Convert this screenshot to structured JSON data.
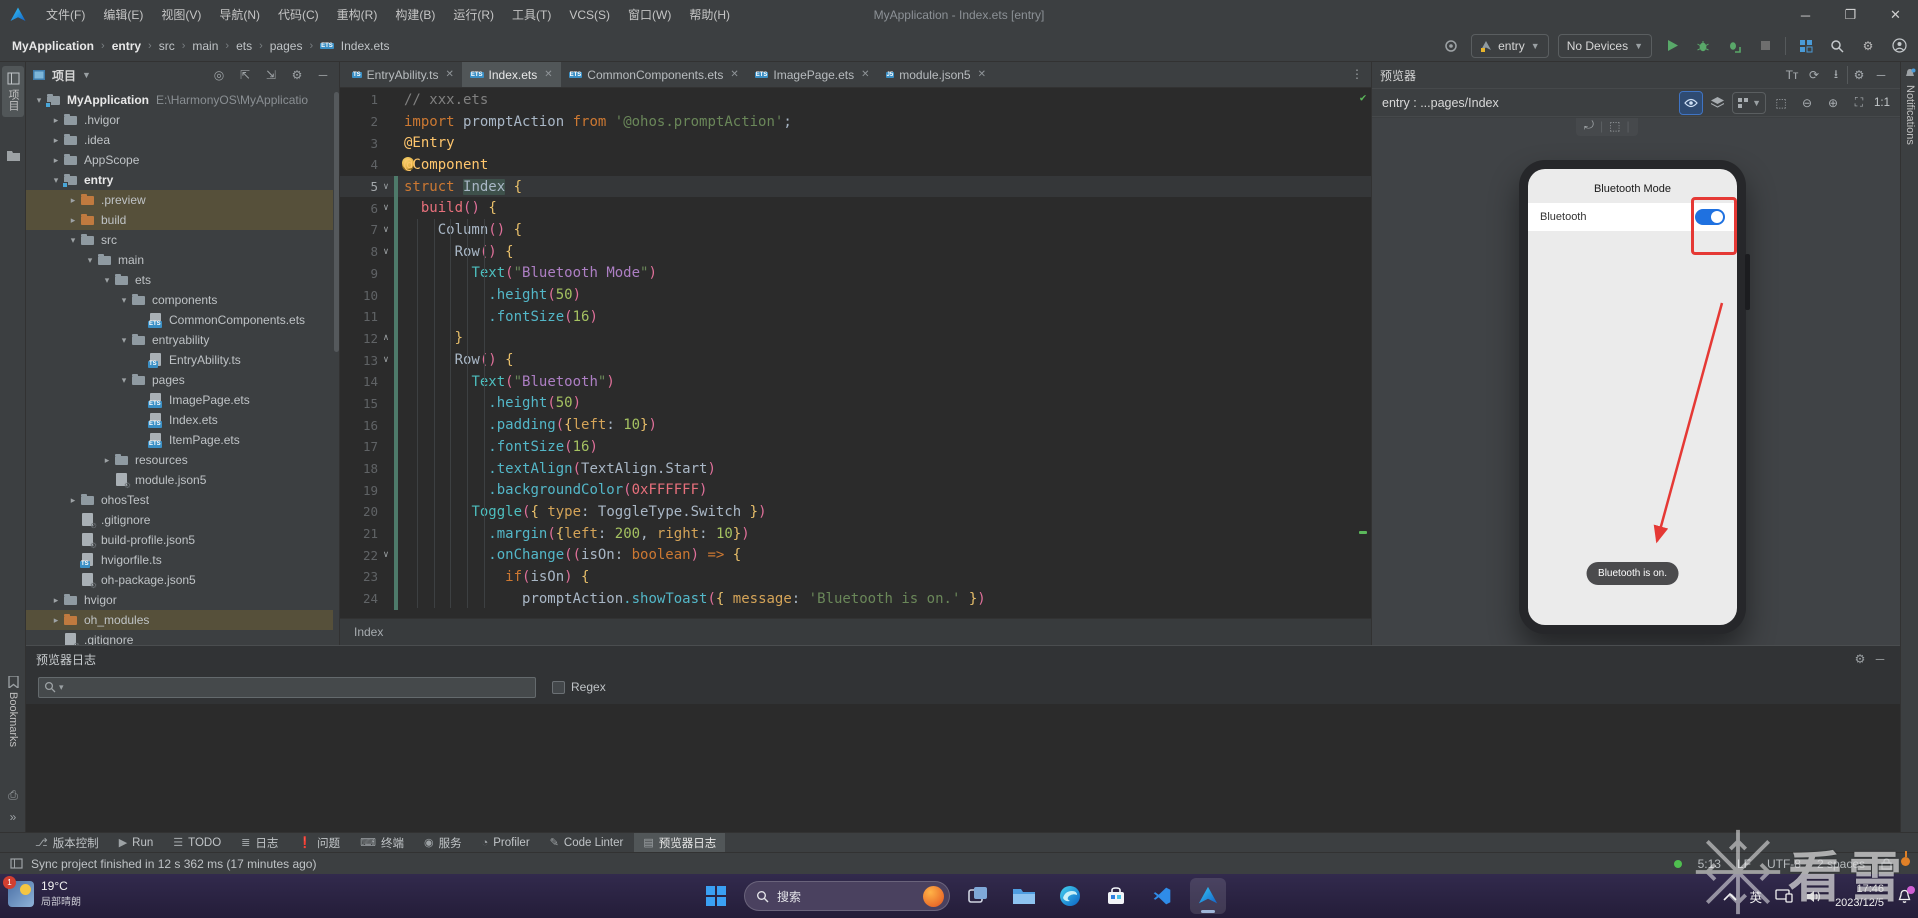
{
  "window": {
    "title": "MyApplication - Index.ets [entry]",
    "menus": [
      "文件(F)",
      "编辑(E)",
      "视图(V)",
      "导航(N)",
      "代码(C)",
      "重构(R)",
      "构建(B)",
      "运行(R)",
      "工具(T)",
      "VCS(S)",
      "窗口(W)",
      "帮助(H)"
    ]
  },
  "toolbar": {
    "breadcrumbs": [
      "MyApplication",
      "entry",
      "src",
      "main",
      "ets",
      "pages",
      "Index.ets"
    ],
    "module_selector": "entry",
    "device_selector": "No Devices"
  },
  "left_strip": {
    "project_tab": "项目",
    "bookmarks_tab": "Bookmarks"
  },
  "project": {
    "title": "项目",
    "tree": [
      {
        "label": "MyApplication",
        "depth": 0,
        "kind": "folder",
        "open": true,
        "bold": true,
        "badge": true,
        "suffix": "E:\\HarmonyOS\\MyApplicatio"
      },
      {
        "label": ".hvigor",
        "depth": 1,
        "kind": "folder",
        "open": false
      },
      {
        "label": ".idea",
        "depth": 1,
        "kind": "folder",
        "open": false
      },
      {
        "label": "AppScope",
        "depth": 1,
        "kind": "folder",
        "open": false
      },
      {
        "label": "entry",
        "depth": 1,
        "kind": "folder",
        "open": true,
        "bold": true,
        "badge": true
      },
      {
        "label": ".preview",
        "depth": 2,
        "kind": "folder-excluded",
        "open": false,
        "highlight": true
      },
      {
        "label": "build",
        "depth": 2,
        "kind": "folder-excluded",
        "open": false,
        "highlight": true
      },
      {
        "label": "src",
        "depth": 2,
        "kind": "folder",
        "open": true
      },
      {
        "label": "main",
        "depth": 3,
        "kind": "folder",
        "open": true
      },
      {
        "label": "ets",
        "depth": 4,
        "kind": "folder",
        "open": true
      },
      {
        "label": "components",
        "depth": 5,
        "kind": "folder",
        "open": true
      },
      {
        "label": "CommonComponents.ets",
        "depth": 6,
        "kind": "file-ets"
      },
      {
        "label": "entryability",
        "depth": 5,
        "kind": "folder",
        "open": true
      },
      {
        "label": "EntryAbility.ts",
        "depth": 6,
        "kind": "file-ts"
      },
      {
        "label": "pages",
        "depth": 5,
        "kind": "folder",
        "open": true
      },
      {
        "label": "ImagePage.ets",
        "depth": 6,
        "kind": "file-ets"
      },
      {
        "label": "Index.ets",
        "depth": 6,
        "kind": "file-ets"
      },
      {
        "label": "ItemPage.ets",
        "depth": 6,
        "kind": "file-ets"
      },
      {
        "label": "resources",
        "depth": 4,
        "kind": "folder",
        "open": false
      },
      {
        "label": "module.json5",
        "depth": 4,
        "kind": "file-json"
      },
      {
        "label": "ohosTest",
        "depth": 2,
        "kind": "folder",
        "open": false
      },
      {
        "label": ".gitignore",
        "depth": 2,
        "kind": "file-ignored"
      },
      {
        "label": "build-profile.json5",
        "depth": 2,
        "kind": "file-json"
      },
      {
        "label": "hvigorfile.ts",
        "depth": 2,
        "kind": "file-ts"
      },
      {
        "label": "oh-package.json5",
        "depth": 2,
        "kind": "file-json"
      },
      {
        "label": "hvigor",
        "depth": 1,
        "kind": "folder",
        "open": false
      },
      {
        "label": "oh_modules",
        "depth": 1,
        "kind": "folder-excluded",
        "open": false,
        "highlight": true
      },
      {
        "label": ".gitignore",
        "depth": 1,
        "kind": "file-ignored"
      }
    ]
  },
  "tabs": [
    {
      "label": "EntryAbility.ts",
      "icon": "TS",
      "active": false
    },
    {
      "label": "Index.ets",
      "icon": "ETS",
      "active": true
    },
    {
      "label": "CommonComponents.ets",
      "icon": "ETS",
      "active": false
    },
    {
      "label": "ImagePage.ets",
      "icon": "ETS",
      "active": false
    },
    {
      "label": "module.json5",
      "icon": "J5",
      "active": false
    }
  ],
  "editor": {
    "current_line": 5,
    "breadcrumb": "Index",
    "lines": [
      {
        "n": 1,
        "ind": 0,
        "tokens": [
          [
            "cmt",
            "// xxx.ets"
          ]
        ]
      },
      {
        "n": 2,
        "ind": 0,
        "tokens": [
          [
            "kw",
            "import"
          ],
          [
            "pl",
            " "
          ],
          [
            "id",
            "promptAction"
          ],
          [
            "pl",
            " "
          ],
          [
            "kw",
            "from"
          ],
          [
            "pl",
            " "
          ],
          [
            "str",
            "'@ohos.promptAction'"
          ],
          [
            "pl",
            ";"
          ]
        ]
      },
      {
        "n": 3,
        "ind": 0,
        "tokens": [
          [
            "dec",
            "@Entry"
          ]
        ]
      },
      {
        "n": 4,
        "ind": 0,
        "tokens": [
          [
            "dec",
            "@Component"
          ]
        ]
      },
      {
        "n": 5,
        "ind": 0,
        "fold": "v",
        "tokens": [
          [
            "kw",
            "struct"
          ],
          [
            "pl",
            " "
          ],
          [
            "hl",
            "Index"
          ],
          [
            "pl",
            " "
          ],
          [
            "br",
            "{"
          ]
        ]
      },
      {
        "n": 6,
        "ind": 2,
        "fold": "v",
        "tokens": [
          [
            "fn",
            "build"
          ],
          [
            "par",
            "()"
          ],
          [
            "pl",
            " "
          ],
          [
            "br",
            "{"
          ]
        ]
      },
      {
        "n": 7,
        "ind": 4,
        "fold": "v",
        "tokens": [
          [
            "id",
            "Column"
          ],
          [
            "par",
            "()"
          ],
          [
            "pl",
            " "
          ],
          [
            "br",
            "{"
          ]
        ]
      },
      {
        "n": 8,
        "ind": 6,
        "fold": "v",
        "tokens": [
          [
            "id",
            "Row"
          ],
          [
            "par",
            "()"
          ],
          [
            "pl",
            " "
          ],
          [
            "br",
            "{"
          ]
        ]
      },
      {
        "n": 9,
        "ind": 8,
        "tokens": [
          [
            "comp",
            "Text"
          ],
          [
            "par",
            "("
          ],
          [
            "str",
            "\""
          ],
          [
            "strp",
            "Bluetooth Mode"
          ],
          [
            "str",
            "\""
          ],
          [
            "par",
            ")"
          ]
        ]
      },
      {
        "n": 10,
        "ind": 10,
        "tokens": [
          [
            "meth",
            ".height"
          ],
          [
            "par",
            "("
          ],
          [
            "num",
            "50"
          ],
          [
            "par",
            ")"
          ]
        ]
      },
      {
        "n": 11,
        "ind": 10,
        "tokens": [
          [
            "meth",
            ".fontSize"
          ],
          [
            "par",
            "("
          ],
          [
            "num",
            "16"
          ],
          [
            "par",
            ")"
          ]
        ]
      },
      {
        "n": 12,
        "ind": 6,
        "fold": "^",
        "tokens": [
          [
            "br",
            "}"
          ]
        ]
      },
      {
        "n": 13,
        "ind": 6,
        "fold": "v",
        "tokens": [
          [
            "id",
            "Row"
          ],
          [
            "par",
            "()"
          ],
          [
            "pl",
            " "
          ],
          [
            "br",
            "{"
          ]
        ]
      },
      {
        "n": 14,
        "ind": 8,
        "tokens": [
          [
            "comp",
            "Text"
          ],
          [
            "par",
            "("
          ],
          [
            "str",
            "\""
          ],
          [
            "strp",
            "Bluetooth"
          ],
          [
            "str",
            "\""
          ],
          [
            "par",
            ")"
          ]
        ]
      },
      {
        "n": 15,
        "ind": 10,
        "tokens": [
          [
            "meth",
            ".height"
          ],
          [
            "par",
            "("
          ],
          [
            "num",
            "50"
          ],
          [
            "par",
            ")"
          ]
        ]
      },
      {
        "n": 16,
        "ind": 10,
        "tokens": [
          [
            "meth",
            ".padding"
          ],
          [
            "par",
            "("
          ],
          [
            "br",
            "{"
          ],
          [
            "pr",
            "left"
          ],
          [
            "pl",
            ": "
          ],
          [
            "num",
            "10"
          ],
          [
            "br",
            "}"
          ],
          [
            "par",
            ")"
          ]
        ]
      },
      {
        "n": 17,
        "ind": 10,
        "tokens": [
          [
            "meth",
            ".fontSize"
          ],
          [
            "par",
            "("
          ],
          [
            "num",
            "16"
          ],
          [
            "par",
            ")"
          ]
        ]
      },
      {
        "n": 18,
        "ind": 10,
        "tokens": [
          [
            "meth",
            ".textAlign"
          ],
          [
            "par",
            "("
          ],
          [
            "id",
            "TextAlign.Start"
          ],
          [
            "par",
            ")"
          ]
        ]
      },
      {
        "n": 19,
        "ind": 10,
        "tokens": [
          [
            "meth",
            ".backgroundColor"
          ],
          [
            "par",
            "("
          ],
          [
            "hex",
            "0xFFFFFF"
          ],
          [
            "par",
            ")"
          ]
        ]
      },
      {
        "n": 20,
        "ind": 8,
        "tokens": [
          [
            "comp",
            "Toggle"
          ],
          [
            "par",
            "("
          ],
          [
            "br",
            "{"
          ],
          [
            "pl",
            " "
          ],
          [
            "pr",
            "type"
          ],
          [
            "pl",
            ": "
          ],
          [
            "id",
            "ToggleType.Switch"
          ],
          [
            "pl",
            " "
          ],
          [
            "br",
            "}"
          ],
          [
            "par",
            ")"
          ]
        ]
      },
      {
        "n": 21,
        "ind": 10,
        "tokens": [
          [
            "meth",
            ".margin"
          ],
          [
            "par",
            "("
          ],
          [
            "br",
            "{"
          ],
          [
            "pr",
            "left"
          ],
          [
            "pl",
            ": "
          ],
          [
            "num",
            "200"
          ],
          [
            "pl",
            ", "
          ],
          [
            "pr",
            "right"
          ],
          [
            "pl",
            ": "
          ],
          [
            "num",
            "10"
          ],
          [
            "br",
            "}"
          ],
          [
            "par",
            ")"
          ]
        ]
      },
      {
        "n": 22,
        "ind": 10,
        "fold": "v",
        "tokens": [
          [
            "meth",
            ".onChange"
          ],
          [
            "par",
            "(("
          ],
          [
            "id",
            "isOn"
          ],
          [
            "pl",
            ": "
          ],
          [
            "kw",
            "boolean"
          ],
          [
            "par",
            ")"
          ],
          [
            "pl",
            " "
          ],
          [
            "arr",
            "=>"
          ],
          [
            "pl",
            " "
          ],
          [
            "br",
            "{"
          ]
        ]
      },
      {
        "n": 23,
        "ind": 12,
        "tokens": [
          [
            "kw",
            "if"
          ],
          [
            "par",
            "("
          ],
          [
            "id",
            "isOn"
          ],
          [
            "par",
            ")"
          ],
          [
            "pl",
            " "
          ],
          [
            "br",
            "{"
          ]
        ]
      },
      {
        "n": 24,
        "ind": 14,
        "tokens": [
          [
            "id",
            "promptAction"
          ],
          [
            "meth",
            ".showToast"
          ],
          [
            "par",
            "("
          ],
          [
            "br",
            "{"
          ],
          [
            "pl",
            " "
          ],
          [
            "pr",
            "message"
          ],
          [
            "pl",
            ": "
          ],
          [
            "str",
            "'Bluetooth is on.'"
          ],
          [
            "pl",
            " "
          ],
          [
            "br",
            "}"
          ],
          [
            "par",
            ")"
          ]
        ]
      }
    ]
  },
  "previewer": {
    "title": "预览器",
    "target": "entry : ...pages/Index",
    "ratio_label": "1:1",
    "side_tab": "Notifications",
    "phone": {
      "screen_title": "Bluetooth Mode",
      "row_label": "Bluetooth",
      "toast": "Bluetooth is on.",
      "toggle_color": "#1f71e0",
      "annotation_color": "#e53935"
    }
  },
  "log_panel": {
    "title": "预览器日志",
    "regex_label": "Regex",
    "search_value": ""
  },
  "tool_buttons": [
    {
      "label": "版本控制",
      "icon": "git-branch",
      "active": false
    },
    {
      "label": "Run",
      "icon": "play",
      "active": false
    },
    {
      "label": "TODO",
      "icon": "checklist",
      "active": false
    },
    {
      "label": "日志",
      "icon": "log",
      "active": false
    },
    {
      "label": "问题",
      "icon": "problems",
      "active": false
    },
    {
      "label": "终端",
      "icon": "terminal",
      "active": false
    },
    {
      "label": "服务",
      "icon": "services",
      "active": false
    },
    {
      "label": "Profiler",
      "icon": "gauge",
      "active": false
    },
    {
      "label": "Code Linter",
      "icon": "linter",
      "active": false
    },
    {
      "label": "预览器日志",
      "icon": "preview-log",
      "active": true
    }
  ],
  "status_bar": {
    "message": "Sync project finished in 12 s 362 ms (17 minutes ago)",
    "caret_position": "5:13",
    "line_separator": "LF",
    "encoding": "UTF-8",
    "indent": "2 spaces"
  },
  "taskbar": {
    "weather_temp": "19°C",
    "weather_condition": "局部晴朗",
    "weather_badge": "1",
    "search_label": "搜索",
    "ime": "英",
    "time": "17:46",
    "date": "2023/12/5"
  },
  "watermark": "看雪"
}
